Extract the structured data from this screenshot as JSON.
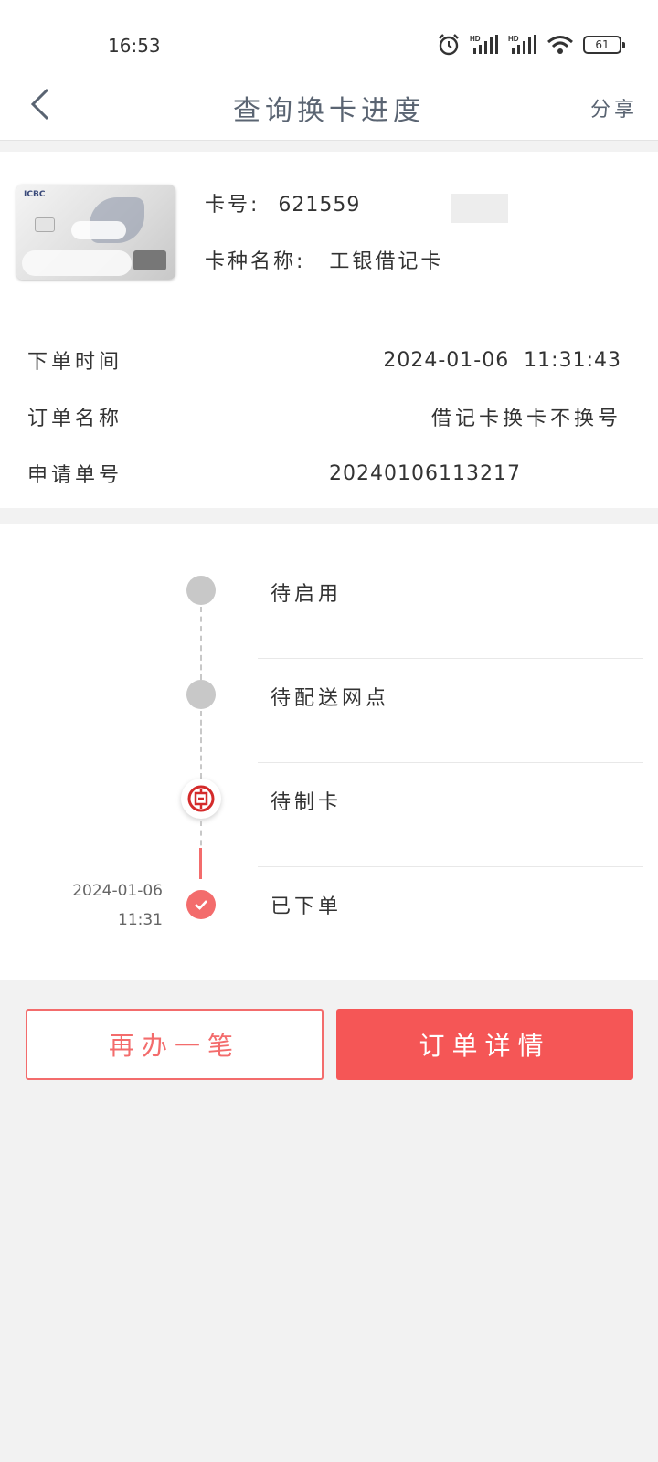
{
  "status_bar": {
    "time": "16:53",
    "battery": "61",
    "icons": [
      "alarm-icon",
      "hd-signal-icon",
      "hd-signal-icon",
      "wifi-icon",
      "battery-icon"
    ]
  },
  "nav": {
    "title": "查询换卡进度",
    "share": "分享",
    "back_icon": "chevron-left-icon"
  },
  "card": {
    "brand": "ICBC",
    "number_label": "卡号:",
    "number": "621559",
    "type_label": "卡种名称:",
    "type": "工银借记卡"
  },
  "order": {
    "rows": [
      {
        "label": "下单时间",
        "value": "2024-01-06  11:31:43"
      },
      {
        "label": "订单名称",
        "value": "借记卡换卡不换号"
      },
      {
        "label": "申请单号",
        "value": "20240106113217"
      }
    ]
  },
  "timeline": {
    "steps": [
      {
        "label": "待启用",
        "status": "pending"
      },
      {
        "label": "待配送网点",
        "status": "pending"
      },
      {
        "label": "待制卡",
        "status": "current",
        "icon": "icbc-logo-icon"
      },
      {
        "label": "已下单",
        "status": "done",
        "date": "2024-01-06",
        "time": "11:31",
        "icon": "check-icon"
      }
    ]
  },
  "actions": {
    "again": "再办一笔",
    "details": "订单详情"
  },
  "colors": {
    "accent": "#f55656",
    "pending": "#c8c8c8",
    "title": "#5a6472"
  }
}
